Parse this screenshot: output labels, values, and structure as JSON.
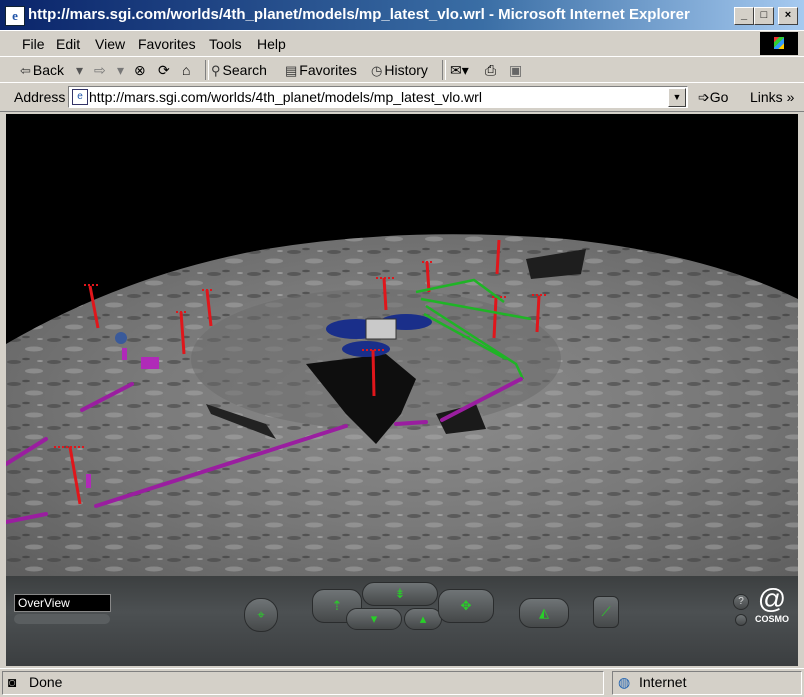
{
  "window": {
    "title": "http://mars.sgi.com/worlds/4th_planet/models/mp_latest_vlo.wrl - Microsoft Internet Explorer",
    "controls": {
      "minimize": "_",
      "maximize": "□",
      "close": "×"
    }
  },
  "menu": {
    "items": [
      {
        "label": "File"
      },
      {
        "label": "Edit"
      },
      {
        "label": "View"
      },
      {
        "label": "Favorites"
      },
      {
        "label": "Tools"
      },
      {
        "label": "Help"
      }
    ]
  },
  "toolbar": {
    "back": "Back",
    "search": "Search",
    "favorites": "Favorites",
    "history": "History"
  },
  "address": {
    "label": "Address",
    "url": "http://mars.sgi.com/worlds/4th_planet/models/mp_latest_vlo.wrl",
    "go": "Go",
    "links": "Links"
  },
  "viewer": {
    "viewpoint": "OverView",
    "brand": "COSMO"
  },
  "status": {
    "text": "Done",
    "zone": "Internet"
  },
  "colors": {
    "title_gradient_start": "#0a246a",
    "chrome": "#d4d0c8",
    "marker_red": "#e0161b",
    "path_purple": "#9a1ea0",
    "path_green": "#1fb426",
    "lander_blue": "#1a2f8a"
  }
}
